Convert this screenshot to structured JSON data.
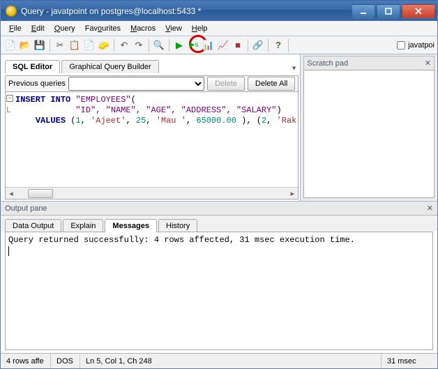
{
  "window": {
    "title": "Query - javatpoint on postgres@localhost:5433 *"
  },
  "menubar": {
    "file": "File",
    "edit": "Edit",
    "query": "Query",
    "favourites": "Favourites",
    "macros": "Macros",
    "view": "View",
    "help": "Help"
  },
  "toolbar": {
    "checkbox_label": "javatpoi"
  },
  "scratchpad": {
    "title": "Scratch pad"
  },
  "editor_tabs": {
    "sql_editor": "SQL Editor",
    "graphical": "Graphical Query Builder"
  },
  "prev_queries": {
    "label": "Previous queries",
    "delete": "Delete",
    "delete_all": "Delete All"
  },
  "sql": {
    "insert": "INSERT",
    "into": "INTO",
    "table": "\"EMPLOYEES\"",
    "open_paren": "(",
    "cols": "\"ID\", \"NAME\", \"AGE\", \"ADDRESS\", \"SALARY\"",
    "close_paren": ")",
    "values_kw": "VALUES",
    "values_body": " (1, 'Ajeet', 25, 'Mau ', 65000.00 ), (2, 'Rak"
  },
  "output": {
    "pane_title": "Output pane",
    "tabs": {
      "data_output": "Data Output",
      "explain": "Explain",
      "messages": "Messages",
      "history": "History"
    },
    "message": "Query returned successfully: 4 rows affected, 31 msec execution time."
  },
  "status": {
    "rows": "4 rows affe",
    "mode": "DOS",
    "pos": "Ln 5, Col 1, Ch 248",
    "time": "31 msec"
  }
}
